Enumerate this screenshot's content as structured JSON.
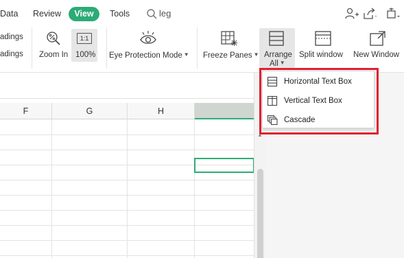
{
  "menubar": {
    "tabs": [
      "Data",
      "Review",
      "View",
      "Tools"
    ],
    "active_tab": "View",
    "search_text": "leg",
    "icons": [
      "add-user-icon",
      "share-icon",
      "collapse-icon"
    ]
  },
  "ribbon": {
    "headings_top": "adings",
    "headings_bottom": "adings",
    "zoom_in": "Zoom In",
    "zoom_100_badge": "1:1",
    "zoom_100": "100%",
    "eye_protection": "Eye Protection Mode",
    "freeze_panes": "Freeze Panes",
    "arrange_all_line1": "Arrange",
    "arrange_all_line2": "All",
    "split_window": "Split window",
    "new_window": "New Window"
  },
  "sheet": {
    "columns": [
      "F",
      "G",
      "H",
      ""
    ],
    "selected_column_index": 3
  },
  "dropdown": {
    "items": [
      {
        "label": "Horizontal Text Box",
        "icon": "horizontal-tile-icon"
      },
      {
        "label": "Vertical Text Box",
        "icon": "vertical-tile-icon"
      },
      {
        "label": "Cascade",
        "icon": "cascade-icon"
      }
    ]
  },
  "colors": {
    "accent": "#2dab77",
    "highlight": "#e0202e"
  }
}
